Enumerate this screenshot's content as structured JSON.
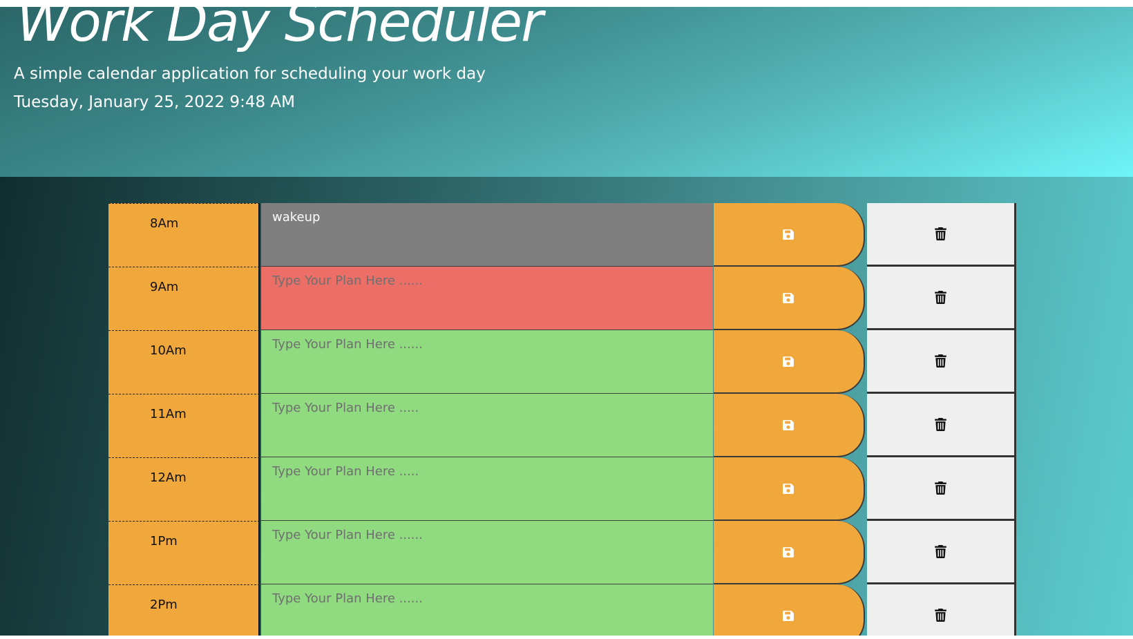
{
  "header": {
    "title": "Work Day Scheduler",
    "subtitle": "A simple calendar application for scheduling your work day",
    "current_datetime": "Tuesday, January 25, 2022 9:48 AM"
  },
  "colors": {
    "hour_block": "#f0a83d",
    "past": "#7f7f7f",
    "present": "#ec6f67",
    "future": "#90db80",
    "delete_button": "#efefef"
  },
  "icons": {
    "save": "floppy-disk-icon",
    "delete": "trash-icon"
  },
  "time_blocks": [
    {
      "hour": "8Am",
      "state": "past",
      "text": "wakeup",
      "placeholder": "Type Your Plan Here ......"
    },
    {
      "hour": "9Am",
      "state": "present",
      "text": "",
      "placeholder": "Type Your Plan Here ......"
    },
    {
      "hour": "10Am",
      "state": "future",
      "text": "",
      "placeholder": "Type Your Plan Here ......"
    },
    {
      "hour": "11Am",
      "state": "future",
      "text": "",
      "placeholder": "Type Your Plan Here ....."
    },
    {
      "hour": "12Am",
      "state": "future",
      "text": "",
      "placeholder": "Type Your Plan Here ....."
    },
    {
      "hour": "1Pm",
      "state": "future",
      "text": "",
      "placeholder": "Type Your Plan Here ......"
    },
    {
      "hour": "2Pm",
      "state": "future",
      "text": "",
      "placeholder": "Type Your Plan Here ......"
    }
  ]
}
